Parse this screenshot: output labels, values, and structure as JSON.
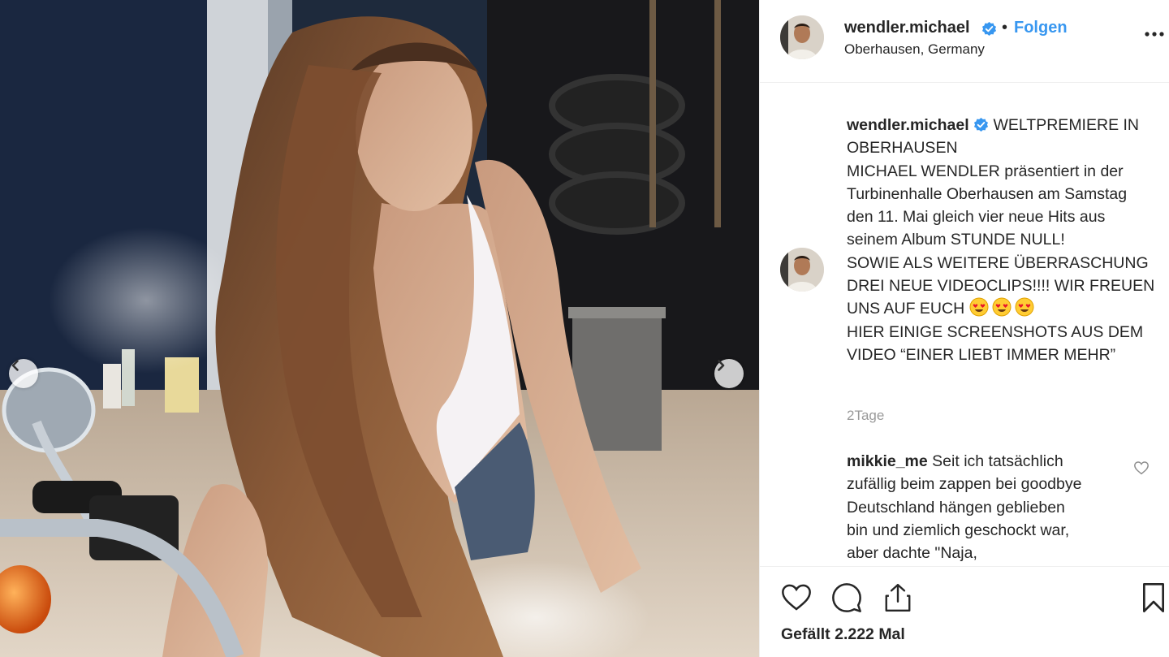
{
  "post": {
    "username": "wendler.michael",
    "separator": "•",
    "follow_label": "Folgen",
    "location": "Oberhausen, Germany",
    "verified_icon": "verified-badge-icon",
    "accent_color": "#3897f0"
  },
  "caption": {
    "username": "wendler.michael",
    "line1": "WELTPREMIERE IN OBERHAUSEN",
    "line2": "MICHAEL WENDLER präsentiert in der Turbinenhalle Oberhausen am Samstag den 11. Mai gleich vier neue Hits aus seinem Album STUNDE NULL!",
    "line3": "SOWIE ALS WEITERE ÜBERRASCHUNG DREI NEUE VIDEOCLIPS!!!! WIR FREUEN UNS AUF EUCH",
    "emojis": [
      "heart-eyes-emoji",
      "heart-eyes-emoji",
      "heart-eyes-emoji"
    ],
    "line4": "HIER EINIGE SCREENSHOTS AUS DEM VIDEO “EINER LIEBT IMMER MEHR”",
    "time": "2Tage"
  },
  "comment": {
    "username": "mikkie_me",
    "text": "Seit ich tatsächlich zufällig beim zappen bei goodbye Deutschland hängen geblieben bin und ziemlich geschockt war, aber dachte \"Naja,"
  },
  "actions": {
    "likes": "Gefällt 2.222 Mal",
    "icons": [
      "heart-icon",
      "comment-icon",
      "share-icon",
      "bookmark-icon"
    ]
  },
  "media": {
    "carousel_prev_icon": "chevron-left-icon",
    "carousel_next_icon": "chevron-right-icon"
  }
}
